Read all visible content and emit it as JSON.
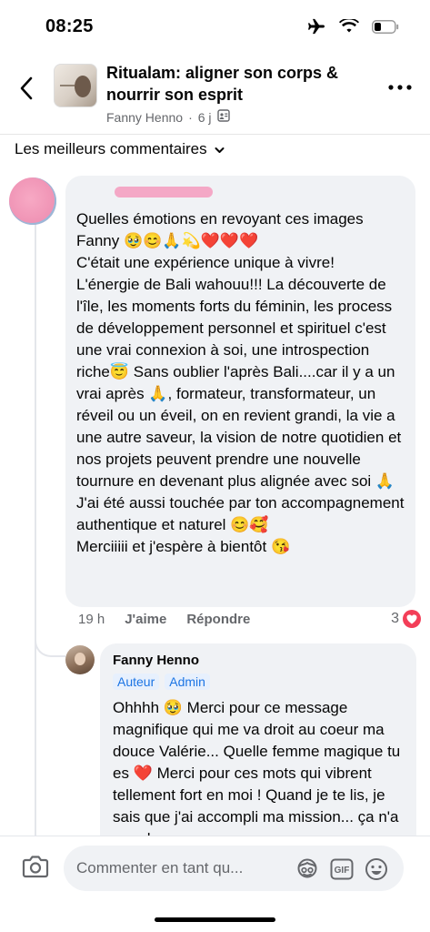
{
  "status_bar": {
    "time": "08:25"
  },
  "header": {
    "title": "Ritualam: aligner son corps & nourrir son esprit",
    "author": "Fanny Henno",
    "age": "6 j",
    "separator": "·"
  },
  "sort": {
    "label": "Les meilleurs commentaires"
  },
  "comment": {
    "text": "Quelles émotions en revoyant ces images Fanny 🥹😊🙏💫❤️❤️❤️\nC'était une expérience unique à vivre!\nL'énergie de Bali wahouu!!! La découverte de l'île, les moments forts du féminin, les process de développement personnel et spirituel c'est une vrai connexion à soi, une introspection riche😇 Sans oublier l'après Bali....car il y a un vrai après 🙏, formateur, transformateur, un réveil ou un éveil, on en revient grandi, la vie a une autre saveur, la vision de notre quotidien et nos projets peuvent prendre une nouvelle tournure en devenant plus alignée avec soi 🙏\nJ'ai été aussi touchée par ton accompagnement authentique et naturel 😊🥰\nMerciiiii et j'espère à bientôt 😘",
    "time": "19 h",
    "like_label": "J'aime",
    "reply_label": "Répondre",
    "reaction_count": "3"
  },
  "reply": {
    "name": "Fanny Henno",
    "badge_author": "Auteur",
    "badge_admin": "Admin",
    "text": "Ohhhh 🥹 Merci pour ce message magnifique qui me va droit au coeur ma douce Valérie... Quelle femme magique tu es ❤️ Merci pour ces mots qui vibrent tellement fort en moi ! Quand je te lis, je sais que j'ai accompli ma mission... ça n'a pas de"
  },
  "composer": {
    "placeholder": "Commenter en tant qu..."
  },
  "colors": {
    "accent": "#1b74e4",
    "heart": "#f33e58",
    "bubble": "#f0f2f5",
    "muted": "#65676b"
  },
  "icons": [
    "airplane-icon",
    "wifi-icon",
    "battery-icon",
    "back-icon",
    "group-visibility-icon",
    "more-icon",
    "camera-icon",
    "avatar-sticker-icon",
    "gif-icon",
    "emoji-icon",
    "heart-icon"
  ]
}
